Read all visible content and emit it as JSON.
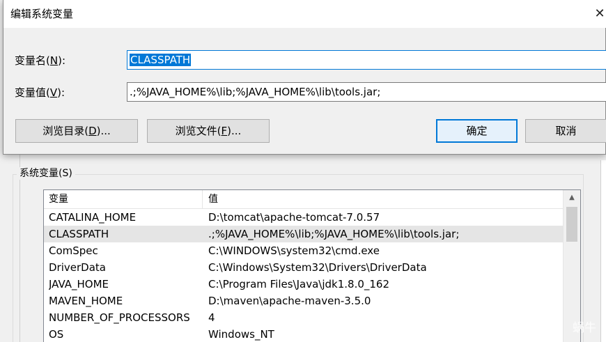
{
  "dialog": {
    "title": "编辑系统变量",
    "close_glyph": "✕",
    "name_label_prefix": "变量名(",
    "name_label_key": "N",
    "name_label_suffix": "):",
    "name_value": "CLASSPATH",
    "value_label_prefix": "变量值(",
    "value_label_key": "V",
    "value_label_suffix": "):",
    "value_value": ".;%JAVA_HOME%\\lib;%JAVA_HOME%\\lib\\tools.jar;",
    "browse_dir_prefix": "浏览目录(",
    "browse_dir_key": "D",
    "browse_dir_suffix": ")...",
    "browse_file_prefix": "浏览文件(",
    "browse_file_key": "F",
    "browse_file_suffix": ")...",
    "ok_label": "确定",
    "cancel_label": "取消"
  },
  "system_variables": {
    "group_label": "系统变量(S)",
    "columns": [
      "变量",
      "值"
    ],
    "rows": [
      {
        "name": "CATALINA_HOME",
        "value": "D:\\tomcat\\apache-tomcat-7.0.57",
        "selected": false
      },
      {
        "name": "CLASSPATH",
        "value": ".;%JAVA_HOME%\\lib;%JAVA_HOME%\\lib\\tools.jar;",
        "selected": true
      },
      {
        "name": "ComSpec",
        "value": "C:\\WINDOWS\\system32\\cmd.exe",
        "selected": false
      },
      {
        "name": "DriverData",
        "value": "C:\\Windows\\System32\\Drivers\\DriverData",
        "selected": false
      },
      {
        "name": "JAVA_HOME",
        "value": "C:\\Program Files\\Java\\jdk1.8.0_162",
        "selected": false
      },
      {
        "name": "MAVEN_HOME",
        "value": "D:\\maven\\apache-maven-3.5.0",
        "selected": false
      },
      {
        "name": "NUMBER_OF_PROCESSORS",
        "value": "4",
        "selected": false
      },
      {
        "name": "OS",
        "value": "Windows_NT",
        "selected": false
      }
    ]
  },
  "watermark": "蜗牛",
  "colors": {
    "accent": "#0078d7",
    "selected_row": "#e5e5e5",
    "button_face": "#e1e1e1"
  }
}
